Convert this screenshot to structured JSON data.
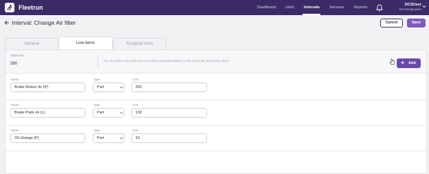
{
  "nav": {
    "brand": "Fleetrun",
    "items": [
      {
        "label": "Dashboard",
        "active": false
      },
      {
        "label": "Units",
        "active": false
      },
      {
        "label": "Intervals",
        "active": true
      },
      {
        "label": "Services",
        "active": false
      },
      {
        "label": "Reports",
        "active": false
      }
    ],
    "user": {
      "name": "DCSUser",
      "org": "DCS Employees"
    }
  },
  "header": {
    "title": "Interval: Change Air filter",
    "cancel_label": "Cancel",
    "save_label": "Save"
  },
  "tabs": [
    {
      "label": "General",
      "active": false
    },
    {
      "label": "Line items",
      "active": true
    },
    {
      "label": "Assigned units",
      "active": false
    }
  ],
  "summary": {
    "total_label": "Total cost",
    "total_value": "390",
    "hint": "You can either enter total cost or it will be calculated based on the cost of all entered line items",
    "add_label": "Add"
  },
  "labels": {
    "name": "Name",
    "type": "Type",
    "cost": "Cost"
  },
  "line_items": [
    {
      "name": "Brake Rotors 4x (P)",
      "type": "Part",
      "cost": "250"
    },
    {
      "name": "Brake Pads 4x (L)",
      "type": "Part",
      "cost": "130"
    },
    {
      "name": "Oil change (P)",
      "type": "Part",
      "cost": "10"
    }
  ],
  "colors": {
    "topbar": "#3b2a66",
    "accent": "#7e5bbd",
    "add_button": "#6a4aa8"
  },
  "icons": [
    "app-logo-icon",
    "bell-icon",
    "caret-down-icon",
    "back-arrow-icon",
    "plus-icon",
    "hand-cursor-icon",
    "chevron-down-icon"
  ]
}
